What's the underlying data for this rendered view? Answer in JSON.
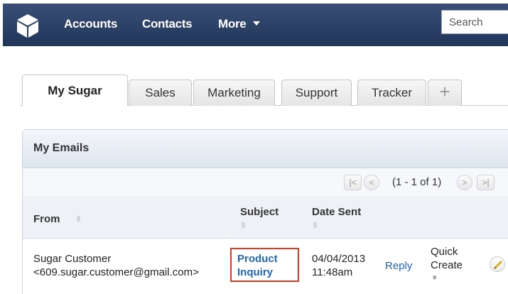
{
  "nav": {
    "items": [
      "Accounts",
      "Contacts",
      "More"
    ],
    "search_placeholder": "Search",
    "logo_icon": "sugar-cube-icon"
  },
  "tabs": [
    {
      "label": "My Sugar",
      "active": true
    },
    {
      "label": "Sales"
    },
    {
      "label": "Marketing"
    },
    {
      "label": "Support"
    },
    {
      "label": "Tracker"
    },
    {
      "label": "+"
    }
  ],
  "dashlet": {
    "title": "My Emails",
    "pager": {
      "text": "(1 - 1 of 1)",
      "first": "|<",
      "prev": "<",
      "next": ">",
      "last": ">|"
    },
    "columns": {
      "from": "From",
      "subject": "Subject",
      "date_sent": "Date Sent"
    },
    "sort_glyph": "⇳",
    "rows": [
      {
        "from_name": "Sugar Customer",
        "from_email": "<609.sugar.customer@gmail.com>",
        "subject_line1": "Product",
        "subject_line2": "Inquiry",
        "date": "04/04/2013",
        "time": "11:48am",
        "reply": "Reply",
        "quick_line1": "Quick",
        "quick_line2": "Create",
        "quick_chevron": "»"
      }
    ]
  },
  "colors": {
    "nav_bg": "#2b3f64",
    "link": "#1f66b9",
    "highlight_border": "#e03a22"
  }
}
